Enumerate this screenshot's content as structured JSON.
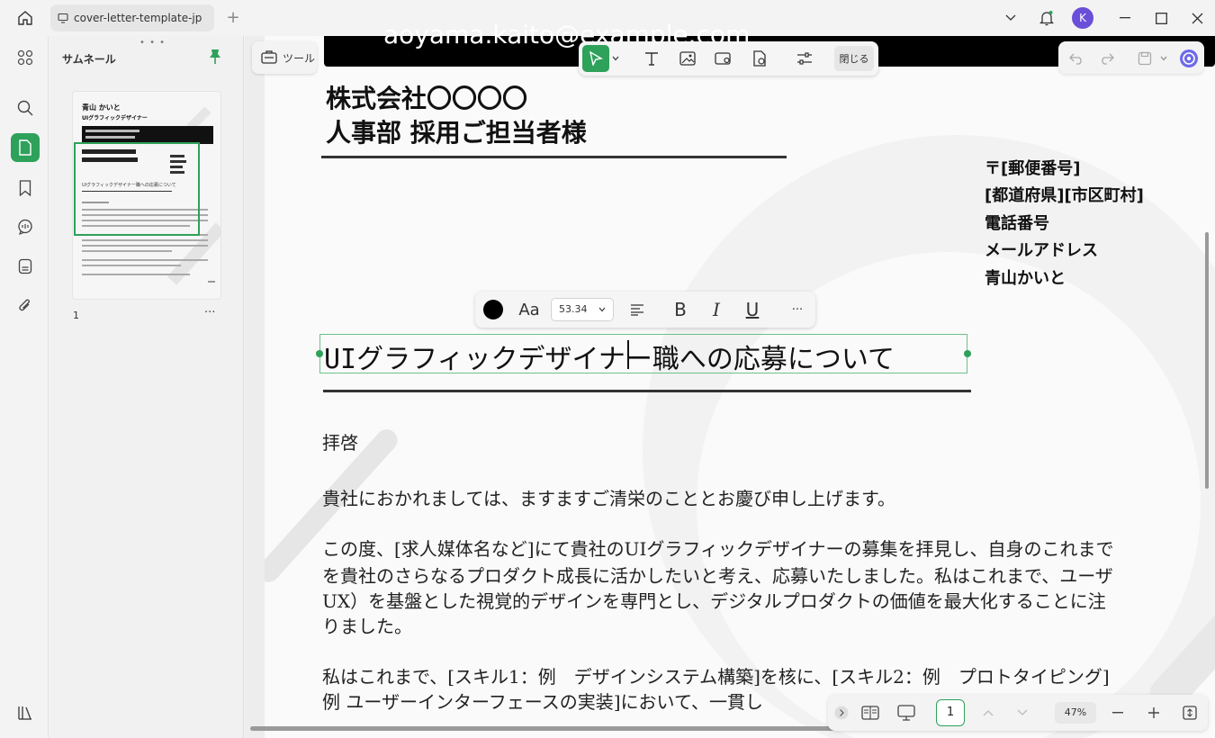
{
  "titlebar": {
    "tab_title": "cover-letter-template-jp",
    "avatar_letter": "K"
  },
  "thumbnails": {
    "title": "サムネール",
    "page_number": "1",
    "more": "···"
  },
  "toolbar": {
    "tools_label": "ツール",
    "close_label": "閉じる"
  },
  "document": {
    "email": "aoyama.kaito@example.com",
    "company": "株式会社〇〇〇〇",
    "dept": "人事部 採用ご担当者様",
    "address": [
      "〒[郵便番号]",
      "[都道府県][市区町村]",
      "電話番号",
      "メールアドレス",
      "青山かいと"
    ],
    "heading": "UIグラフィックデザイナー職への応募について",
    "greeting": "拝啓",
    "para1": "貴社におかれましては、ますますご清栄のこととお慶び申し上げます。",
    "para2": [
      "この度、[求人媒体名など]にて貴社のUIグラフィックデザイナーの募集を拝見し、自身のこれまで",
      "を貴社のさらなるプロダクト成長に活かしたいと考え、応募いたしました。私はこれまで、ユーザ",
      "UX）を基盤とした視覚的デザインを専門とし、デジタルプロダクトの価値を最大化することに注",
      "りました。"
    ],
    "para3": [
      "私はこれまで、[スキル1：例　デザインシステム構築]を核に、[スキル2：例　プロトタイピング]",
      "例 ユーザーインターフェースの実装]において、一貫し"
    ]
  },
  "format_bar": {
    "font_label": "Aa",
    "font_size": "53.34",
    "bold": "B",
    "italic": "I",
    "underline": "U",
    "more": "···"
  },
  "thumb_text": {
    "name": "青山 かいと",
    "role": "UIグラフィックデザイナー",
    "company": "株式会社〇〇〇〇",
    "dept": "人事部 採用ご担当者様",
    "heading": "UIグラフィックデザイナー職への応募について"
  },
  "bottom_bar": {
    "page_value": "1",
    "zoom": "47%"
  }
}
